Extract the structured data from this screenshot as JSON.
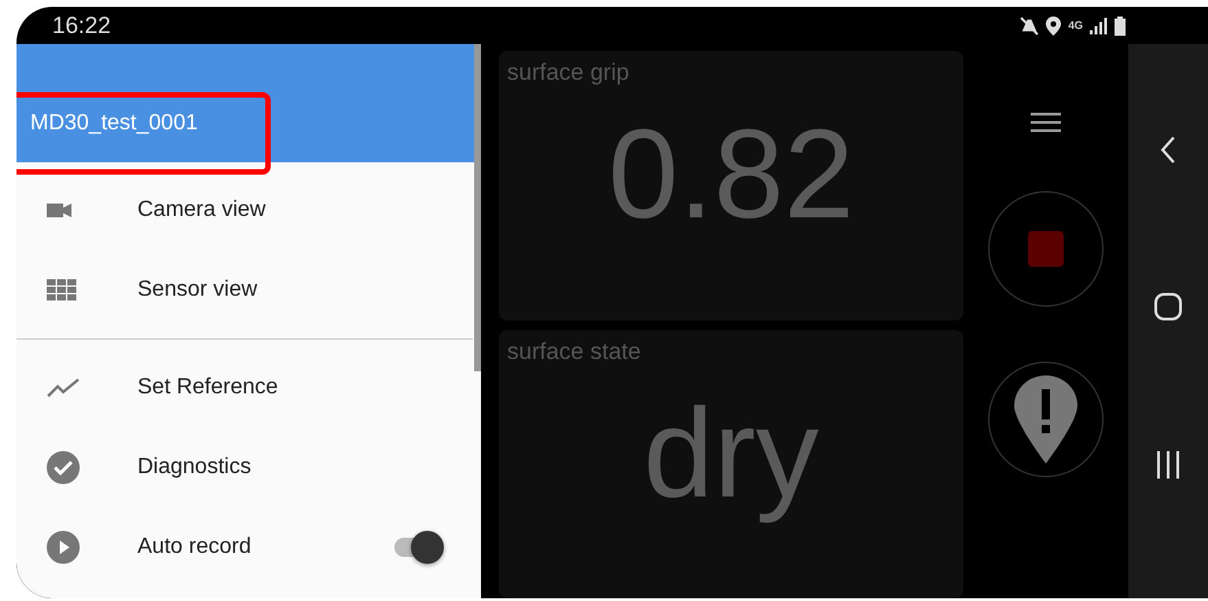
{
  "status_bar": {
    "time": "16:22",
    "network": "4G"
  },
  "drawer": {
    "header": {
      "title": "MD30_test_0001",
      "highlighted": true
    },
    "sections": [
      {
        "items": [
          {
            "kind": "camera",
            "label": "Camera view"
          },
          {
            "kind": "grid",
            "label": "Sensor view"
          }
        ]
      },
      {
        "items": [
          {
            "kind": "trend",
            "label": "Set Reference"
          },
          {
            "kind": "check",
            "label": "Diagnostics"
          },
          {
            "kind": "play",
            "label": "Auto record",
            "toggle": {
              "on": true
            }
          }
        ]
      }
    ]
  },
  "cards": [
    {
      "label": "surface grip",
      "value": "0.82"
    },
    {
      "label": "surface state",
      "value": "dry"
    }
  ],
  "controls": [
    {
      "kind": "stop"
    },
    {
      "kind": "alert"
    }
  ]
}
